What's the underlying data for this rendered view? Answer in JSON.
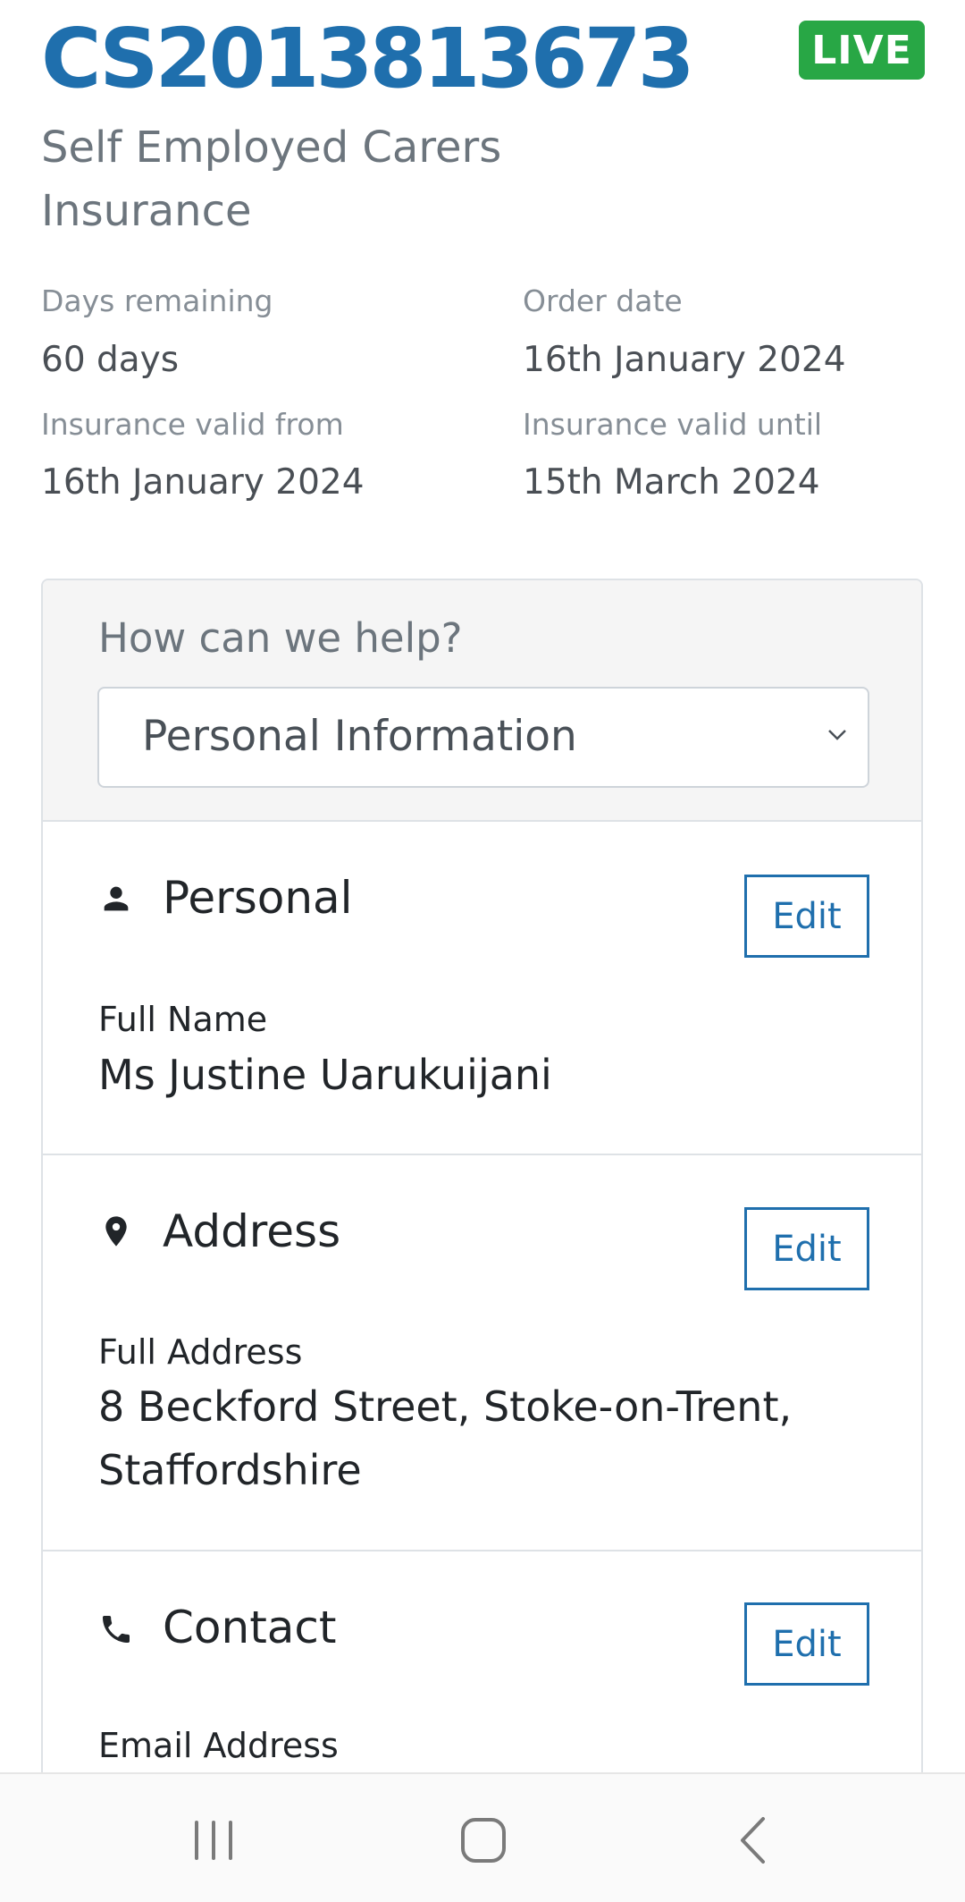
{
  "policy": {
    "reference": "CS2013813673",
    "status": "LIVE",
    "product": "Self Employed Carers Insurance"
  },
  "details": {
    "days_remaining_label": "Days remaining",
    "days_remaining": "60 days",
    "order_date_label": "Order date",
    "order_date": "16th January 2024",
    "valid_from_label": "Insurance valid from",
    "valid_from": "16th January 2024",
    "valid_until_label": "Insurance valid until",
    "valid_until": "15th March 2024"
  },
  "help": {
    "label": "How can we help?",
    "selected_option": "Personal Information"
  },
  "sections": {
    "personal": {
      "title": "Personal",
      "icon": "person-icon",
      "edit_label": "Edit",
      "field_label": "Full Name",
      "field_value": "Ms Justine Uarukuijani"
    },
    "address": {
      "title": "Address",
      "icon": "location-pin-icon",
      "edit_label": "Edit",
      "field_label": "Full Address",
      "field_value": "8 Beckford Street, Stoke-on-Trent, Staffordshire"
    },
    "contact": {
      "title": "Contact",
      "icon": "phone-icon",
      "edit_label": "Edit",
      "field_label": "Email Address"
    }
  },
  "colors": {
    "brand_blue": "#1f6fad",
    "live_green": "#28a745"
  },
  "nav": {
    "icons": [
      "recent-apps-icon",
      "home-icon",
      "back-icon"
    ]
  }
}
